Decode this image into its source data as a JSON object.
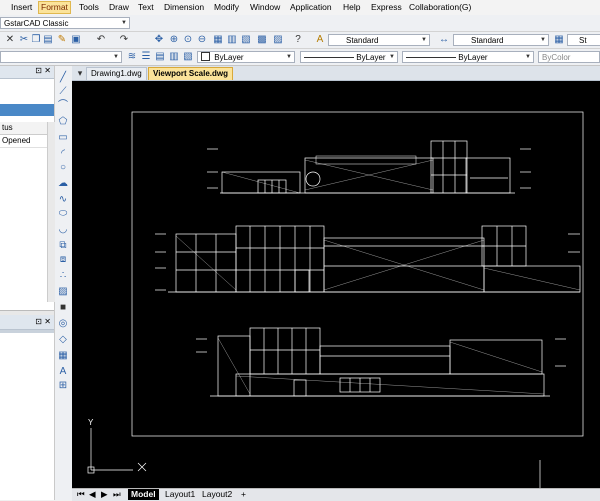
{
  "menu": {
    "items": [
      {
        "label": "Insert",
        "active": false
      },
      {
        "label": "Format",
        "active": true
      },
      {
        "label": "Tools",
        "active": false
      },
      {
        "label": "Draw",
        "active": false
      },
      {
        "label": "Text",
        "active": false
      },
      {
        "label": "Dimension",
        "active": false
      },
      {
        "label": "Modify",
        "active": false
      },
      {
        "label": "Window",
        "active": false
      },
      {
        "label": "Application",
        "active": false
      },
      {
        "label": "Help",
        "active": false
      },
      {
        "label": "Express",
        "active": false
      },
      {
        "label": "Collaboration(G)",
        "active": false
      }
    ]
  },
  "toolbar": {
    "workspace": "GstarCAD Classic",
    "text_style": "Standard",
    "dim_style": "Standard",
    "table_style_partial": "St",
    "layer": "ByLayer",
    "linetype": "ByLayer",
    "lineweight": "ByLayer",
    "plot_style": "ByColor"
  },
  "left_panel": {
    "status_header_partial": "tus",
    "status_value_partial": "Opened"
  },
  "document_tabs": [
    {
      "label": "Drawing1.dwg",
      "active": false
    },
    {
      "label": "Viewport Scale.dwg",
      "active": true
    }
  ],
  "layout_tabs": [
    {
      "label": "Model",
      "active": true
    },
    {
      "label": "Layout1",
      "active": false
    },
    {
      "label": "Layout2",
      "active": false
    },
    {
      "label": "+",
      "active": false
    }
  ],
  "ucs": {
    "x_label": "X",
    "y_label": "Y"
  },
  "colors": {
    "canvas": "#000000",
    "drawing_lines": "#ffffff",
    "active_tab": "#fbe39a"
  }
}
